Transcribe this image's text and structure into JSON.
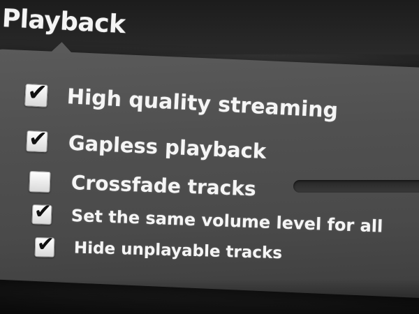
{
  "section": {
    "title": "Playback"
  },
  "options": [
    {
      "label": "High quality streaming",
      "checked": true
    },
    {
      "label": "Gapless playback",
      "checked": true
    },
    {
      "label": "Crossfade tracks",
      "checked": false
    },
    {
      "label": "Set the same volume level for all",
      "checked": true
    },
    {
      "label": "Hide unplayable tracks",
      "checked": true
    }
  ],
  "check_glyph": "✔"
}
